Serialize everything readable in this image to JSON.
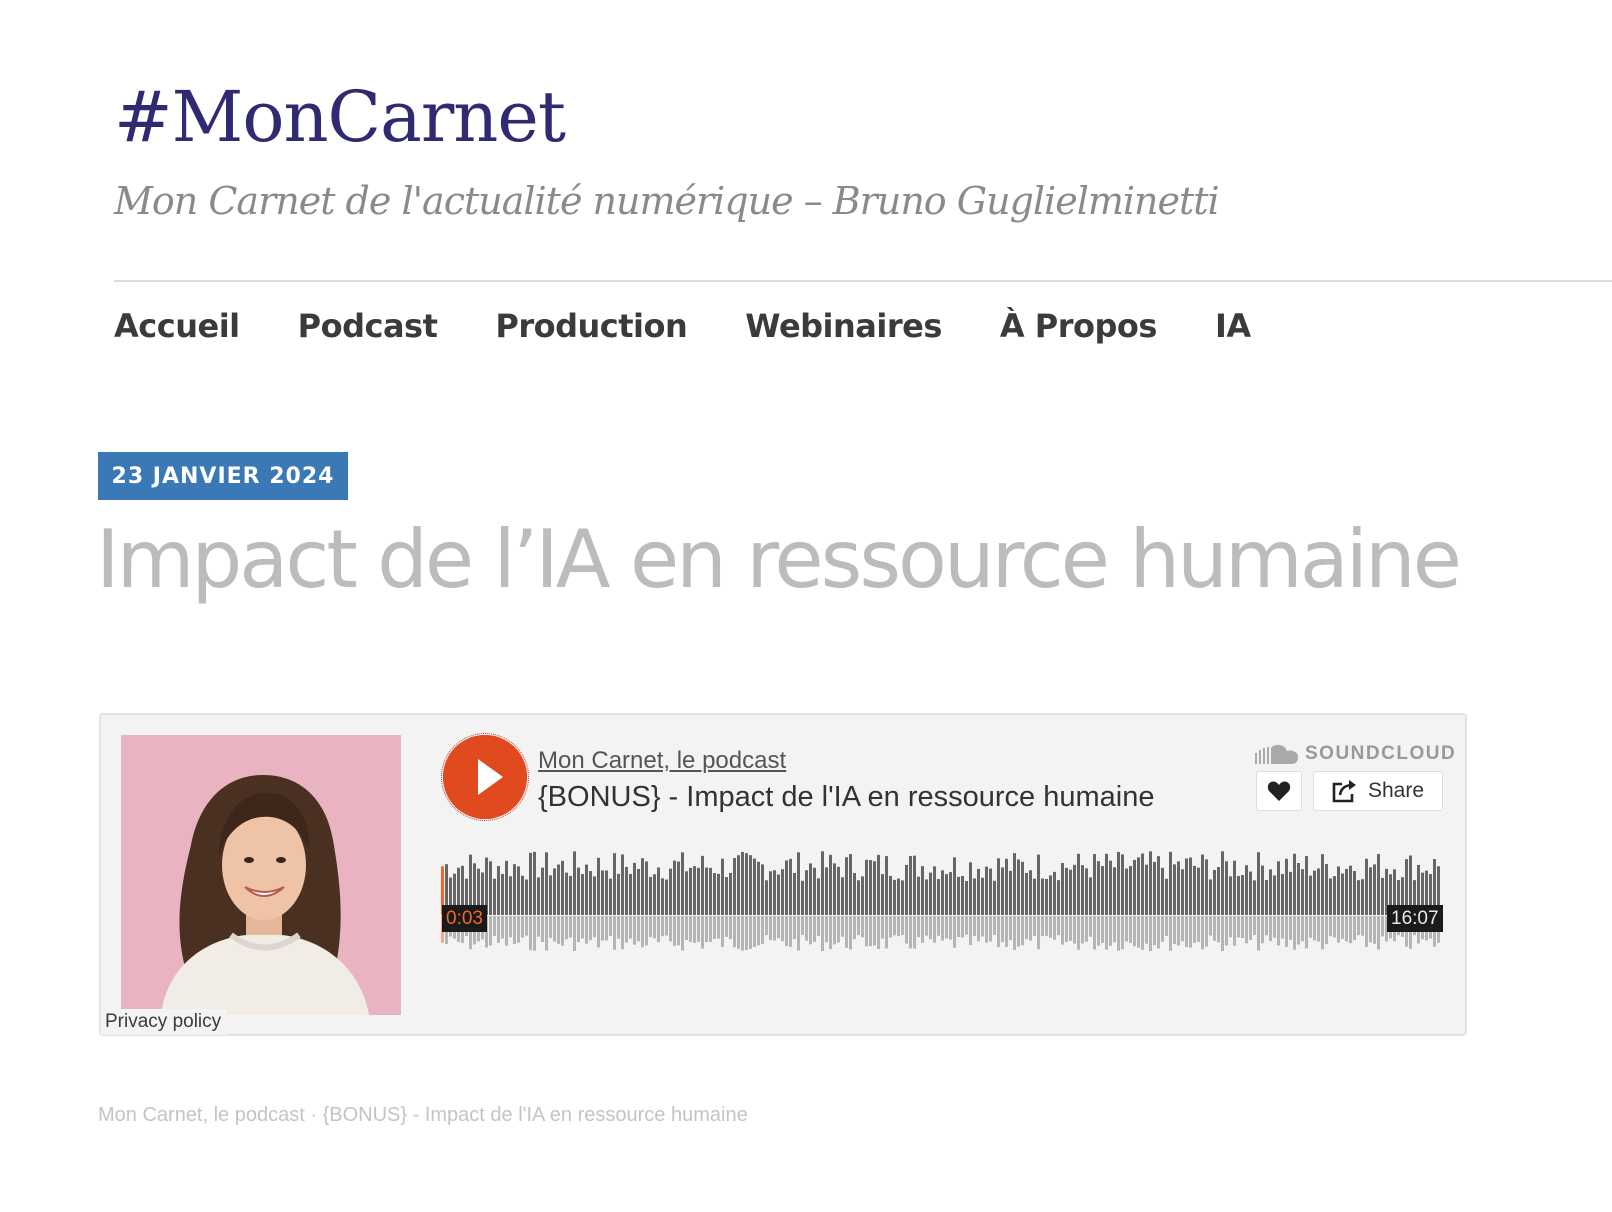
{
  "site": {
    "title": "#MonCarnet",
    "tagline": "Mon Carnet de l'actualité numérique – Bruno Guglielminetti"
  },
  "nav": {
    "items": [
      "Accueil",
      "Podcast",
      "Production",
      "Webinaires",
      "À Propos",
      "IA"
    ]
  },
  "post": {
    "date": "23 JANVIER 2024",
    "title": "Impact de l’IA en ressource humaine"
  },
  "player": {
    "artist": "Mon Carnet, le podcast",
    "track_title": "{BONUS} - Impact de l'IA en ressource humaine",
    "brand": "SOUNDCLOUD",
    "share_label": "Share",
    "current_time": "0:03",
    "total_time": "16:07",
    "progress": 0.003,
    "privacy_label": "Privacy policy",
    "artwork_icon": "avatar-photo",
    "play_icon": "play-icon",
    "like_icon": "heart-icon",
    "share_icon": "share-icon",
    "accent_color": "#e1491f",
    "played_color": "#f2672a"
  },
  "caption": {
    "artist": "Mon Carnet, le podcast",
    "separator": " · ",
    "track": "{BONUS} - Impact de l'IA en ressource humaine"
  }
}
